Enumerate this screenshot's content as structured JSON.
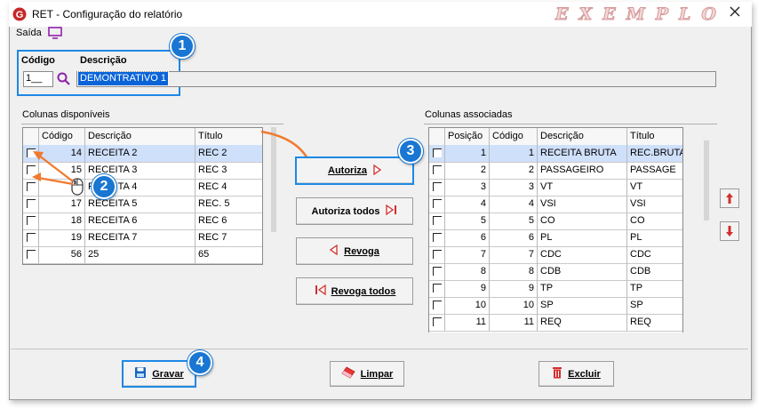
{
  "window": {
    "title": "RET - Configuração do relatório",
    "watermark": "EXEMPLO"
  },
  "menu": {
    "saida_label": "Saída"
  },
  "header": {
    "codigo_label": "Código",
    "descricao_label": "Descrição",
    "codigo_value": "1__",
    "descricao_value": "DEMONTRATIVO 1"
  },
  "available": {
    "title": "Colunas disponíveis",
    "columns": [
      "Código",
      "Descrição",
      "Título"
    ],
    "rows": [
      {
        "codigo": "14",
        "descricao": "RECEITA 2",
        "titulo": "REC 2"
      },
      {
        "codigo": "15",
        "descricao": "RECEITA 3",
        "titulo": "REC 3"
      },
      {
        "codigo": "16",
        "descricao": "RECEITA 4",
        "titulo": "REC 4"
      },
      {
        "codigo": "17",
        "descricao": "RECEITA 5",
        "titulo": "REC. 5"
      },
      {
        "codigo": "18",
        "descricao": "RECEITA 6",
        "titulo": "REC 6"
      },
      {
        "codigo": "19",
        "descricao": "RECEITA 7",
        "titulo": "REC 7"
      },
      {
        "codigo": "56",
        "descricao": "25",
        "titulo": "65"
      }
    ]
  },
  "associated": {
    "title": "Colunas associadas",
    "columns": [
      "Posição",
      "Código",
      "Descrição",
      "Título"
    ],
    "rows": [
      {
        "posicao": "1",
        "codigo": "1",
        "descricao": "RECEITA BRUTA",
        "titulo": "REC.BRUTA"
      },
      {
        "posicao": "2",
        "codigo": "2",
        "descricao": "PASSAGEIRO",
        "titulo": "PASSAGE"
      },
      {
        "posicao": "3",
        "codigo": "3",
        "descricao": "VT",
        "titulo": "VT"
      },
      {
        "posicao": "4",
        "codigo": "4",
        "descricao": "VSI",
        "titulo": "VSI"
      },
      {
        "posicao": "5",
        "codigo": "5",
        "descricao": "CO",
        "titulo": "CO"
      },
      {
        "posicao": "6",
        "codigo": "6",
        "descricao": "PL",
        "titulo": "PL"
      },
      {
        "posicao": "7",
        "codigo": "7",
        "descricao": "CDC",
        "titulo": "CDC"
      },
      {
        "posicao": "8",
        "codigo": "8",
        "descricao": "CDB",
        "titulo": "CDB"
      },
      {
        "posicao": "9",
        "codigo": "9",
        "descricao": "TP",
        "titulo": "TP"
      },
      {
        "posicao": "10",
        "codigo": "10",
        "descricao": "SP",
        "titulo": "SP"
      },
      {
        "posicao": "11",
        "codigo": "11",
        "descricao": "REQ",
        "titulo": "REQ"
      }
    ]
  },
  "actions": {
    "autoriza": "Autoriza",
    "autoriza_todos": "Autoriza todos",
    "revoga": "Revoga",
    "revoga_todos": "Revoga todos"
  },
  "footer": {
    "gravar": "Gravar",
    "limpar": "Limpar",
    "excluir": "Excluir"
  },
  "badges": [
    "1",
    "2",
    "3",
    "4"
  ],
  "colors": {
    "accent": "#1976d2",
    "highlight_border": "#1e88e5",
    "arrow": "#f07a2e",
    "selected_row": "#cfe0fb",
    "icon_red": "#d32f2f"
  }
}
